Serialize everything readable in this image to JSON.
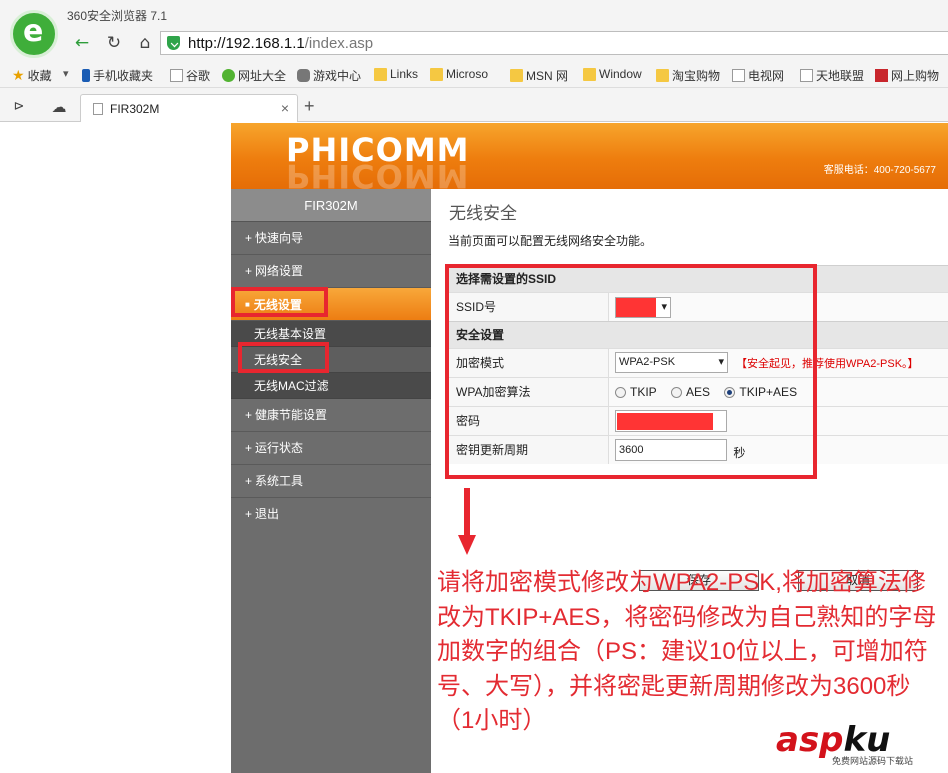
{
  "browser": {
    "title": "360安全浏览器 7.1",
    "url_host": "http://192.168.1.1",
    "url_path": "/index.asp",
    "bookmarks": [
      {
        "label": "收藏",
        "icon": "star-icon"
      },
      {
        "label": "手机收藏夹",
        "icon": "phone-icon"
      },
      {
        "label": "谷歌",
        "icon": "page-icon"
      },
      {
        "label": "网址大全",
        "icon": "plus-circle-icon"
      },
      {
        "label": "游戏中心",
        "icon": "gamepad-icon"
      },
      {
        "label": "Links",
        "icon": "folder-icon"
      },
      {
        "label": "Microso",
        "icon": "folder-icon"
      },
      {
        "label": "MSN 网",
        "icon": "folder-icon"
      },
      {
        "label": "Window",
        "icon": "folder-icon"
      },
      {
        "label": "淘宝购物",
        "icon": "folder-icon"
      },
      {
        "label": "电视网",
        "icon": "page-icon"
      },
      {
        "label": "天地联盟",
        "icon": "page-icon"
      },
      {
        "label": "网上购物",
        "icon": "shop-icon"
      }
    ],
    "tab_title": "FIR302M"
  },
  "router": {
    "brand": "PHICOMM",
    "hotline": "客服电话：400-720-5677",
    "model": "FIR302M",
    "menu": {
      "quick_setup": "快速向导",
      "network": "网络设置",
      "wireless": "无线设置",
      "wireless_basic": "无线基本设置",
      "wireless_security": "无线安全",
      "wireless_mac": "无线MAC过滤",
      "power_saving": "健康节能设置",
      "status": "运行状态",
      "system_tools": "系统工具",
      "logout": "退出"
    },
    "page_title": "无线安全",
    "description": "当前页面可以配置无线网络安全功能。",
    "form": {
      "ssid_section": "选择需设置的SSID",
      "ssid_label": "SSID号",
      "security_section": "安全设置",
      "mode_label": "加密模式",
      "mode_value": "WPA2-PSK",
      "mode_hint": "【安全起见，推荐使用WPA2-PSK。】",
      "algo_label": "WPA加密算法",
      "algo_options": [
        "TKIP",
        "AES",
        "TKIP+AES"
      ],
      "algo_selected": "TKIP+AES",
      "password_label": "密码",
      "rekey_label": "密钥更新周期",
      "rekey_value": "3600",
      "rekey_unit": "秒"
    },
    "buttons": {
      "save": "保存",
      "cancel": "取消"
    }
  },
  "annotation": {
    "text": "请将加密模式修改为WPA2-PSK,将加密算法修改为TKIP+AES，将密码修改为自己熟知的字母加数字的组合（PS：建议10位以上，可增加符号、大写），并将密匙更新周期修改为3600秒（1小时）"
  },
  "watermark": {
    "main_a": "asp",
    "main_b": "ku",
    "sub": "免费网站源码下载站"
  },
  "colors": {
    "accent_orange": "#ee7d0e",
    "annotation_red": "#e8262f",
    "sidebar": "#6d6d6d"
  }
}
